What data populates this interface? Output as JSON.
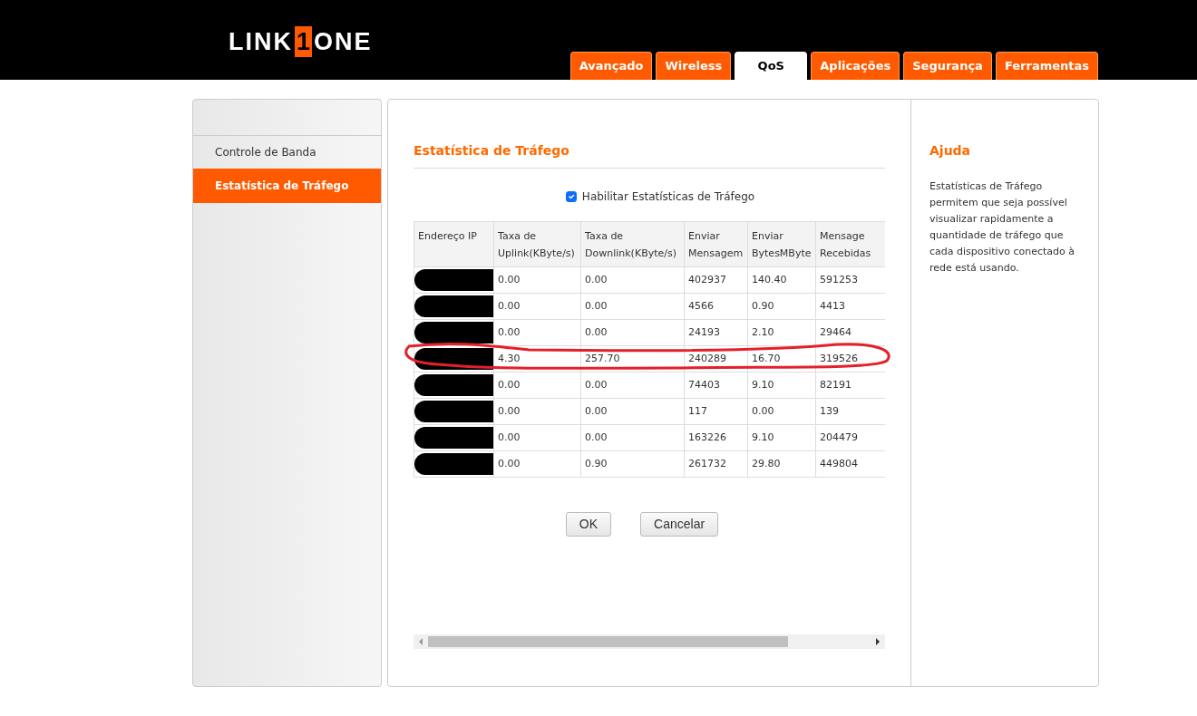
{
  "logo": {
    "left": "LINK",
    "mark": "1",
    "right": "ONE"
  },
  "tabs": [
    {
      "label": "Avançado",
      "selected": false
    },
    {
      "label": "Wireless",
      "selected": false
    },
    {
      "label": "QoS",
      "selected": true
    },
    {
      "label": "Aplicações",
      "selected": false
    },
    {
      "label": "Segurança",
      "selected": false
    },
    {
      "label": "Ferramentas",
      "selected": false
    }
  ],
  "sidebar": {
    "items": [
      {
        "label": "Controle de Banda",
        "selected": false
      },
      {
        "label": "Estatística de Tráfego",
        "selected": true
      }
    ]
  },
  "main": {
    "title": "Estatística de Tráfego",
    "enable": {
      "label": "Habilitar Estatísticas de Tráfego",
      "checked": true
    },
    "table": {
      "columns": [
        "Endereço IP",
        "Taxa de Uplink(KByte/s)",
        "Taxa de Downlink(KByte/s)",
        "Enviar Mensagem",
        "Enviar BytesMByte",
        "Mensage Recebidas"
      ],
      "rows": [
        {
          "ip_redacted": true,
          "highlighted": false,
          "cells": [
            "",
            "0.00",
            "0.00",
            "402937",
            "140.40",
            "591253"
          ]
        },
        {
          "ip_redacted": true,
          "highlighted": false,
          "cells": [
            "",
            "0.00",
            "0.00",
            "4566",
            "0.90",
            "4413"
          ]
        },
        {
          "ip_redacted": true,
          "highlighted": false,
          "cells": [
            "",
            "0.00",
            "0.00",
            "24193",
            "2.10",
            "29464"
          ]
        },
        {
          "ip_redacted": true,
          "highlighted": true,
          "cells": [
            "",
            "4.30",
            "257.70",
            "240289",
            "16.70",
            "319526"
          ]
        },
        {
          "ip_redacted": true,
          "highlighted": false,
          "cells": [
            "",
            "0.00",
            "0.00",
            "74403",
            "9.10",
            "82191"
          ]
        },
        {
          "ip_redacted": true,
          "highlighted": false,
          "cells": [
            "",
            "0.00",
            "0.00",
            "117",
            "0.00",
            "139"
          ]
        },
        {
          "ip_redacted": true,
          "highlighted": false,
          "cells": [
            "",
            "0.00",
            "0.00",
            "163226",
            "9.10",
            "204479"
          ]
        },
        {
          "ip_redacted": true,
          "highlighted": false,
          "cells": [
            "",
            "0.00",
            "0.90",
            "261732",
            "29.80",
            "449804"
          ]
        }
      ]
    },
    "buttons": [
      "OK",
      "Cancelar"
    ]
  },
  "help": {
    "title": "Ajuda",
    "text": "Estatísticas de Tráfego permitem que seja possível visualizar rapidamente a quantidade de tráfego que cada dispositivo conectado à rede está usando."
  }
}
